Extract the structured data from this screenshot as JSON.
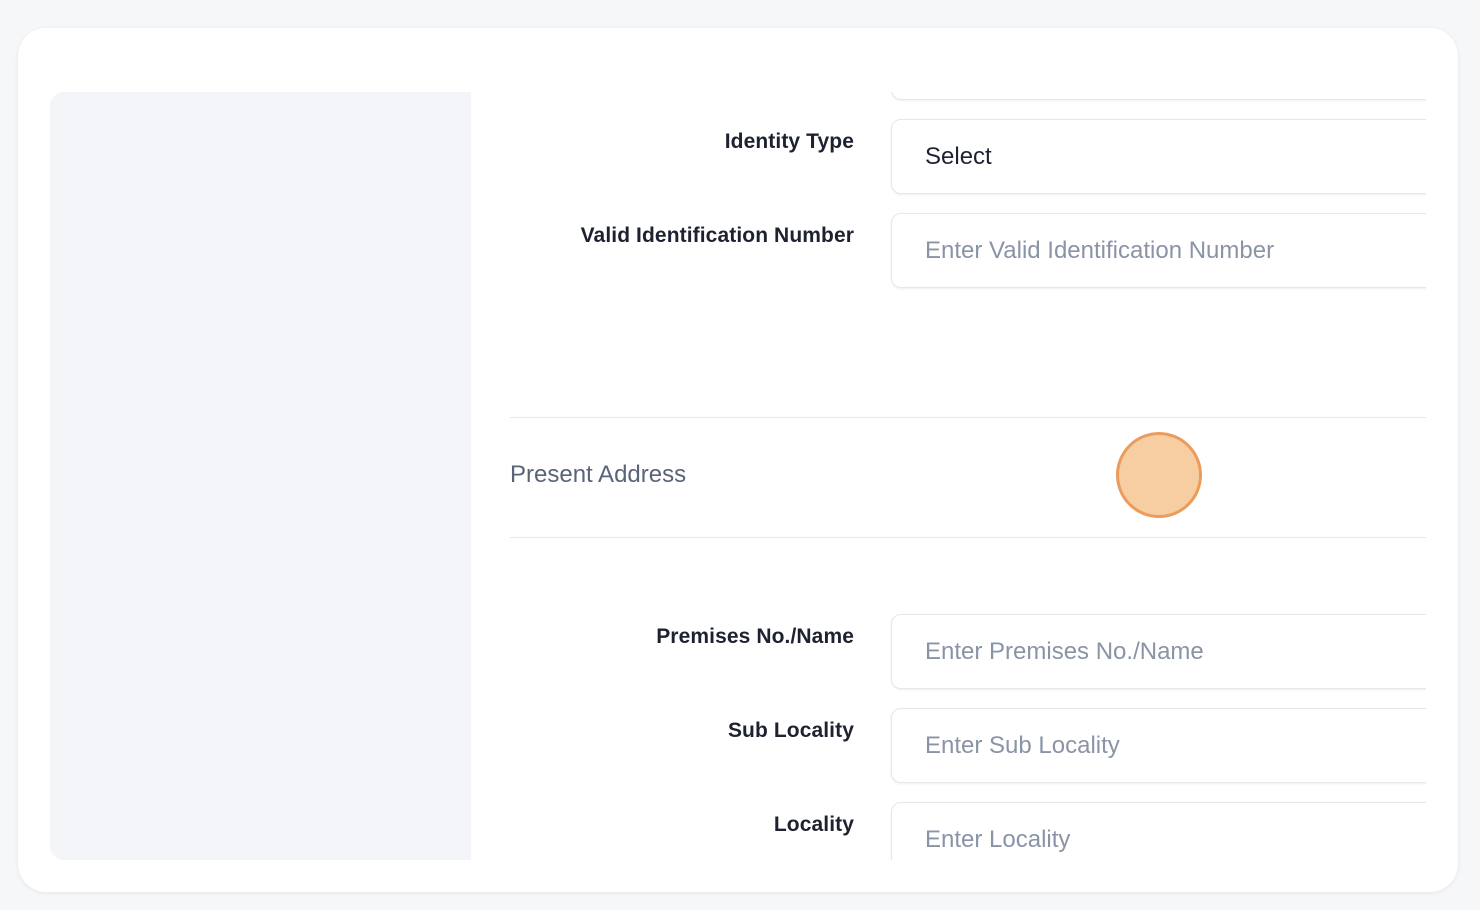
{
  "form": {
    "identity_type": {
      "label": "Identity Type",
      "value": "Select"
    },
    "valid_identification_number": {
      "label": "Valid Identification Number",
      "placeholder": "Enter Valid Identification Number"
    },
    "present_address_section": {
      "title": "Present Address"
    },
    "premises": {
      "label": "Premises No./Name",
      "placeholder": "Enter Premises No./Name"
    },
    "sub_locality": {
      "label": "Sub Locality",
      "placeholder": "Enter Sub Locality"
    },
    "locality": {
      "label": "Locality",
      "placeholder": "Enter Locality"
    }
  },
  "colors": {
    "accent_cursor": "#eb9c5d",
    "label_text": "#1e2230",
    "placeholder_text": "#8a94a6",
    "sidebar_bg": "#f4f5f9"
  }
}
